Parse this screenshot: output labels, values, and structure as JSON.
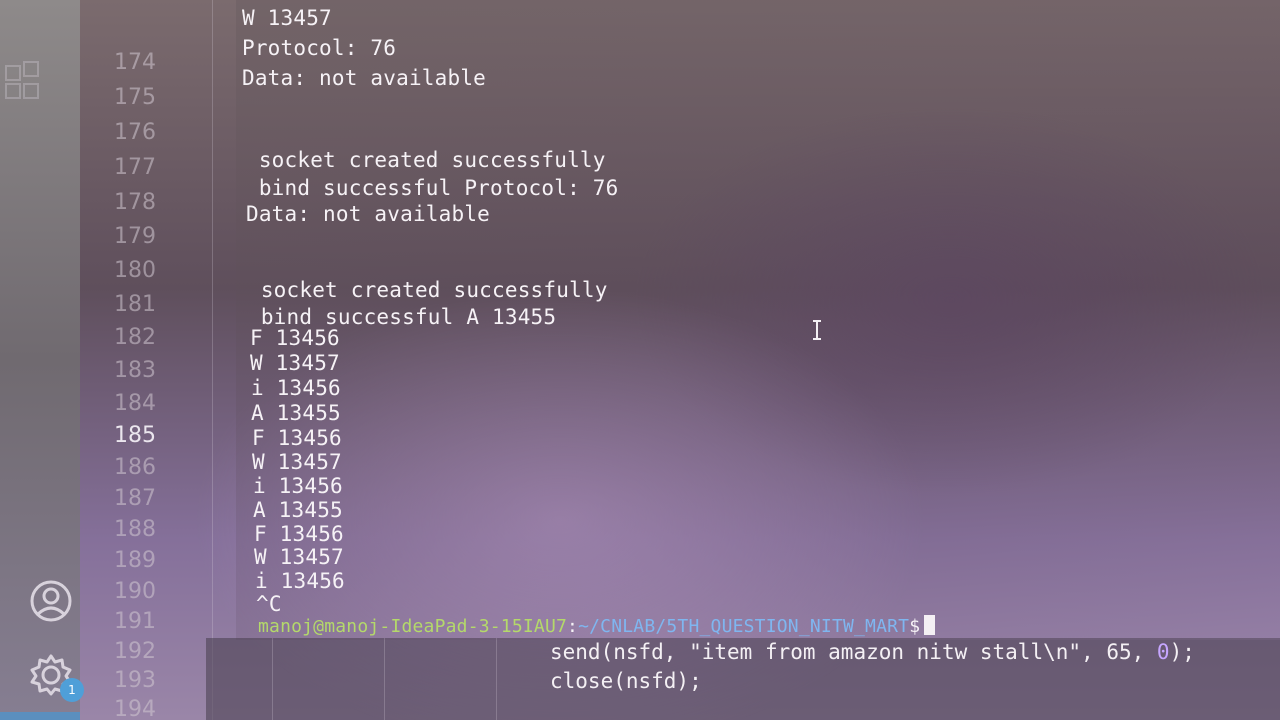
{
  "terminal": {
    "lines": [
      "W 13457",
      "Protocol: 76",
      "Data: not available",
      " socket created successfully",
      " bind successful Protocol: 76",
      "Data: not available",
      " socket created successfully",
      " bind successful A 13455",
      "F 13456",
      "W 13457",
      "i 13456",
      "A 13455",
      "F 13456",
      "W 13457",
      "i 13456",
      "A 13455",
      "F 13456",
      "W 13457",
      "i 13456",
      "^C"
    ],
    "prompt": {
      "user_host": "manoj@manoj-IdeaPad-3-15IAU7",
      "separator": ":",
      "path": "~/CNLAB/5TH_QUESTION_NITW_MART",
      "symbol": "$"
    }
  },
  "editor": {
    "line_numbers": [
      "174",
      "175",
      "176",
      "177",
      "178",
      "179",
      "180",
      "181",
      "182",
      "183",
      "184",
      "185",
      "186",
      "187",
      "188",
      "189",
      "190",
      "191",
      "192",
      "193",
      "194"
    ],
    "current_line": "185",
    "code": {
      "send_fn": "send",
      "send_args": "(nsfd, \"item from amazon nitw stall\\n\", ",
      "send_num1": "65",
      "send_comma": ", ",
      "send_num2": "0",
      "send_end": ");",
      "close_line": "close(nsfd);"
    }
  },
  "activity_bar": {
    "icons": [
      "explorer-icon",
      "account-icon",
      "settings-icon"
    ],
    "settings_badge": "1"
  },
  "colors": {
    "prompt_user": "#b4d96a",
    "prompt_path": "#7fb6f0",
    "badge": "#4f9fd8"
  }
}
